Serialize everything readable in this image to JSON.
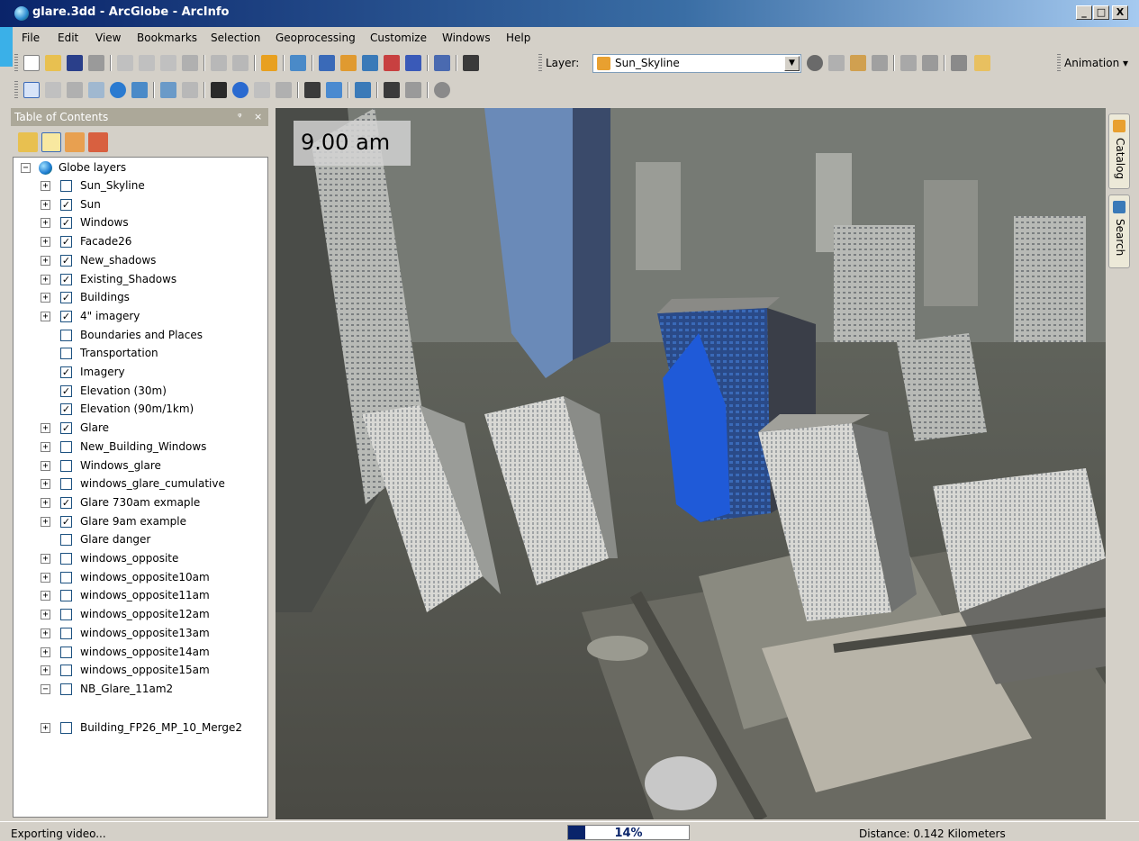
{
  "window": {
    "title": "glare.3dd - ArcGlobe - ArcInfo",
    "min_label": "_",
    "max_label": "□",
    "close_label": "X"
  },
  "menu": [
    "File",
    "Edit",
    "View",
    "Bookmarks",
    "Selection",
    "Geoprocessing",
    "Customize",
    "Windows",
    "Help"
  ],
  "toolbar": {
    "layer_label": "Layer:",
    "layer_value": "Sun_Skyline",
    "animation_label": "Animation ▾"
  },
  "toc": {
    "header": "Table of Contents",
    "pin": "ᵠ",
    "close": "×",
    "root": "Globe layers",
    "layers": [
      {
        "name": "Sun_Skyline",
        "checked": false,
        "expandable": true
      },
      {
        "name": "Sun",
        "checked": true,
        "expandable": true
      },
      {
        "name": "Windows",
        "checked": true,
        "expandable": true
      },
      {
        "name": "Facade26",
        "checked": true,
        "expandable": true
      },
      {
        "name": "New_shadows",
        "checked": true,
        "expandable": true
      },
      {
        "name": "Existing_Shadows",
        "checked": true,
        "expandable": true
      },
      {
        "name": "Buildings",
        "checked": true,
        "expandable": true
      },
      {
        "name": "4\" imagery",
        "checked": true,
        "expandable": true
      },
      {
        "name": "Boundaries and Places",
        "checked": false,
        "expandable": false
      },
      {
        "name": "Transportation",
        "checked": false,
        "expandable": false
      },
      {
        "name": "Imagery",
        "checked": true,
        "expandable": false
      },
      {
        "name": "Elevation (30m)",
        "checked": true,
        "expandable": false
      },
      {
        "name": "Elevation (90m/1km)",
        "checked": true,
        "expandable": false
      },
      {
        "name": "Glare",
        "checked": true,
        "expandable": true
      },
      {
        "name": "New_Building_Windows",
        "checked": false,
        "expandable": true
      },
      {
        "name": "Windows_glare",
        "checked": false,
        "expandable": true
      },
      {
        "name": "windows_glare_cumulative",
        "checked": false,
        "expandable": true
      },
      {
        "name": "Glare 730am exmaple",
        "checked": true,
        "expandable": true
      },
      {
        "name": "Glare 9am example",
        "checked": true,
        "expandable": true
      },
      {
        "name": "Glare danger",
        "checked": false,
        "expandable": false
      },
      {
        "name": "windows_opposite",
        "checked": false,
        "expandable": true
      },
      {
        "name": "windows_opposite10am",
        "checked": false,
        "expandable": true
      },
      {
        "name": "windows_opposite11am",
        "checked": false,
        "expandable": true
      },
      {
        "name": "windows_opposite12am",
        "checked": false,
        "expandable": true
      },
      {
        "name": "windows_opposite13am",
        "checked": false,
        "expandable": true
      },
      {
        "name": "windows_opposite14am",
        "checked": false,
        "expandable": true
      },
      {
        "name": "windows_opposite15am",
        "checked": false,
        "expandable": true
      },
      {
        "name": "NB_Glare_11am2",
        "checked": false,
        "expandable": true,
        "expanded": true
      },
      {
        "name": "Building_FP26_MP_10_Merge2",
        "checked": false,
        "expandable": true
      }
    ]
  },
  "view": {
    "time_label": "9.00 am"
  },
  "dock": {
    "catalog": "Catalog",
    "search": "Search"
  },
  "status": {
    "message": "Exporting video...",
    "progress_percent": 14,
    "progress_label": "14%",
    "distance": "Distance: 0.142 Kilometers"
  },
  "colors": {
    "titlebar_start": "#0a246a",
    "titlebar_end": "#a6caf0",
    "accent_blue": "#3ab0e8",
    "glare_building": "#1f5ad8",
    "progress": "#0a246a"
  }
}
